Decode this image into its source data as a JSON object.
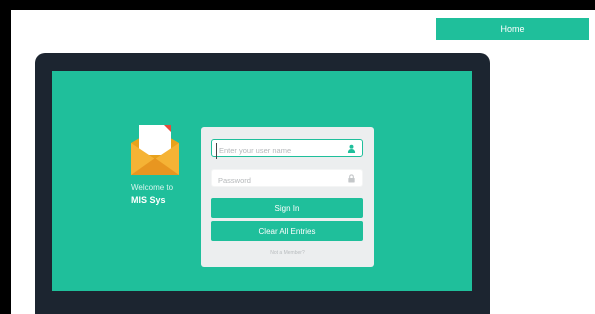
{
  "header": {
    "home_label": "Home"
  },
  "brand": {
    "welcome_text": "Welcome to",
    "name": "MIS Sys"
  },
  "login": {
    "username_placeholder": "Enter your user name",
    "password_placeholder": "Password",
    "signin_label": "Sign In",
    "clear_label": "Clear All Entries",
    "not_member_text": "Not a Member?"
  },
  "colors": {
    "accent": "#1fbf9b",
    "monitor": "#1c2530",
    "card": "#eceeef"
  },
  "icons": {
    "logo": "envelope-icon",
    "username": "user-icon",
    "password": "lock-icon"
  }
}
